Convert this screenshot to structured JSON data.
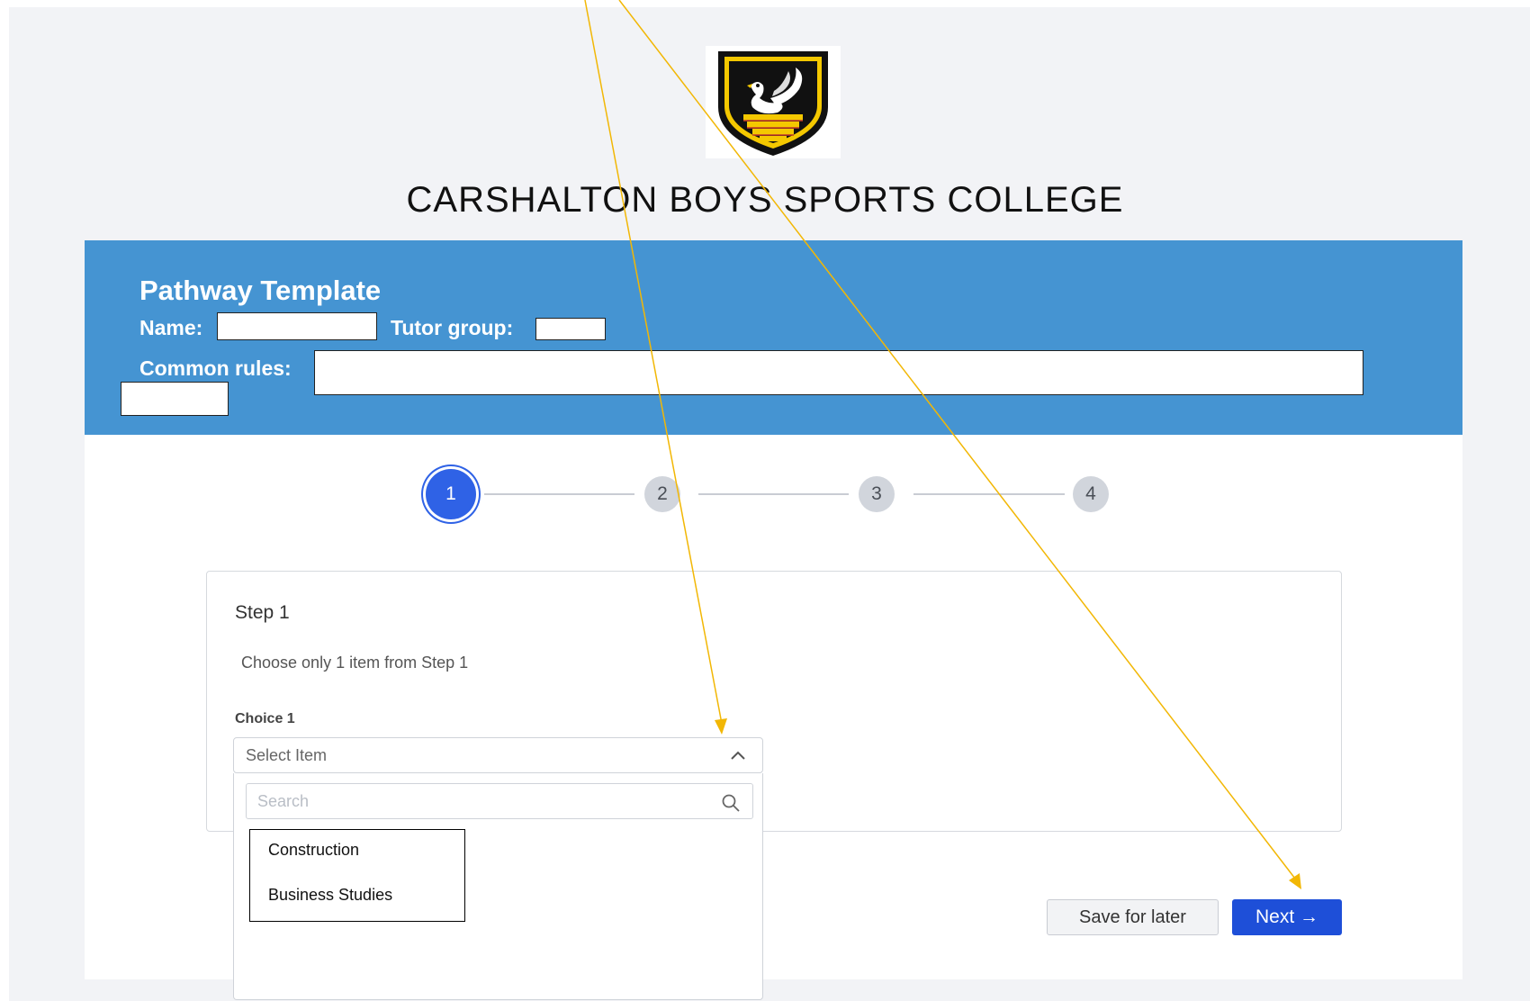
{
  "college": {
    "name": "CARSHALTON BOYS SPORTS COLLEGE"
  },
  "header": {
    "title": "Pathway Template",
    "name_label": "Name:",
    "name_value": "",
    "tutor_label": "Tutor group:",
    "tutor_value": "",
    "rules_label": "Common rules:",
    "rules_value": "",
    "extra_value": ""
  },
  "stepper": {
    "steps": [
      "1",
      "2",
      "3",
      "4"
    ],
    "active_step": "1"
  },
  "step_card": {
    "title": "Step 1",
    "instruction": "Choose only 1 item from Step 1",
    "choice_label": "Choice 1",
    "select_value": "Select Item",
    "search_placeholder": "Search",
    "options": [
      "Construction",
      "Business Studies"
    ]
  },
  "actions": {
    "save_label": "Save for later",
    "next_label": "Next →"
  },
  "colors": {
    "header_band": "#4594d2",
    "primary": "#1e4fd8",
    "annotation_arrow": "#f2b705"
  }
}
